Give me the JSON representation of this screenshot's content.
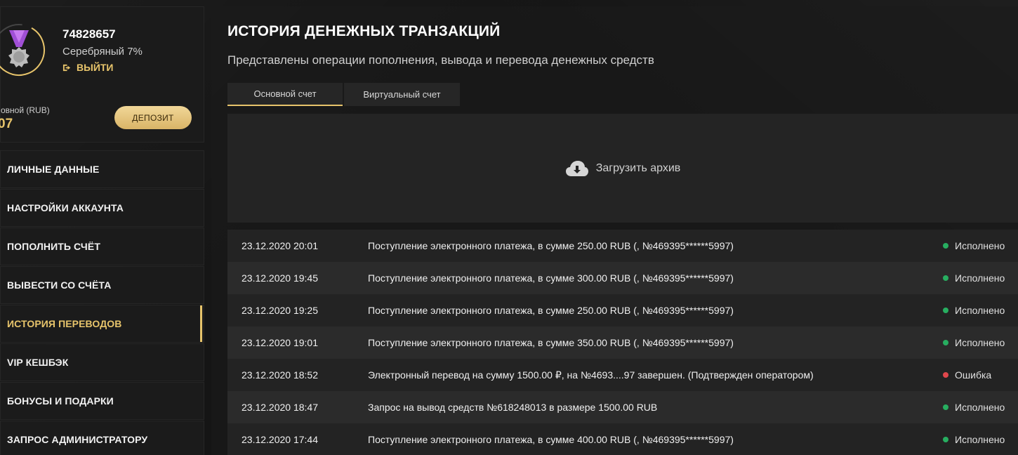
{
  "profile": {
    "user_id": "74828657",
    "level": "Серебряный 7%",
    "logout_label": "ВЫЙТИ",
    "balance_label": "овной (RUB)",
    "balance_value": "07",
    "deposit_label": "ДЕПОЗИТ"
  },
  "menu": [
    {
      "label": "ЛИЧНЫЕ ДАННЫЕ",
      "name": "menu-item-personal-data"
    },
    {
      "label": "НАСТРОЙКИ АККАУНТА",
      "name": "menu-item-account-settings"
    },
    {
      "label": "ПОПОЛНИТЬ СЧЁТ",
      "name": "menu-item-top-up"
    },
    {
      "label": "ВЫВЕСТИ СО СЧЁТА",
      "name": "menu-item-withdraw"
    },
    {
      "label": "ИСТОРИЯ ПЕРЕВОДОВ",
      "name": "menu-item-transfer-history",
      "active": true
    },
    {
      "label": "VIP КЕШБЭК",
      "name": "menu-item-vip-cashback"
    },
    {
      "label": "БОНУСЫ И ПОДАРКИ",
      "name": "menu-item-bonuses"
    },
    {
      "label": "ЗАПРОС АДМИНИСТРАТОРУ",
      "name": "menu-item-admin-request"
    }
  ],
  "main": {
    "title": "ИСТОРИЯ ДЕНЕЖНЫХ ТРАНЗАКЦИЙ",
    "subtitle": "Представлены операции пополнения, вывода и перевода денежных средств",
    "tabs": [
      "Основной счет",
      "Виртуальный счет"
    ],
    "archive_label": "Загрузить архив"
  },
  "colors": {
    "accent": "#e7c46b",
    "success": "#27ae60",
    "error": "#e0474c"
  },
  "transactions": [
    {
      "date": "23.12.2020 20:01",
      "description": "Поступление электронного платежа, в сумме 250.00 RUB (, №469395******5997)",
      "status": "Исполнено",
      "status_type": "success"
    },
    {
      "date": "23.12.2020 19:45",
      "description": "Поступление электронного платежа, в сумме 300.00 RUB (, №469395******5997)",
      "status": "Исполнено",
      "status_type": "success"
    },
    {
      "date": "23.12.2020 19:25",
      "description": "Поступление электронного платежа, в сумме 250.00 RUB (, №469395******5997)",
      "status": "Исполнено",
      "status_type": "success"
    },
    {
      "date": "23.12.2020 19:01",
      "description": "Поступление электронного платежа, в сумме 350.00 RUB (, №469395******5997)",
      "status": "Исполнено",
      "status_type": "success"
    },
    {
      "date": "23.12.2020 18:52",
      "description": "Электронный перевод на сумму 1500.00 ₽, на №4693....97 завершен. (Подтвержден оператором)",
      "status": "Ошибка",
      "status_type": "error"
    },
    {
      "date": "23.12.2020 18:47",
      "description": "Запрос на вывод средств №618248013 в размере 1500.00 RUB",
      "status": "Исполнено",
      "status_type": "success"
    },
    {
      "date": "23.12.2020 17:44",
      "description": "Поступление электронного платежа, в сумме 400.00 RUB (, №469395******5997)",
      "status": "Исполнено",
      "status_type": "success"
    }
  ]
}
